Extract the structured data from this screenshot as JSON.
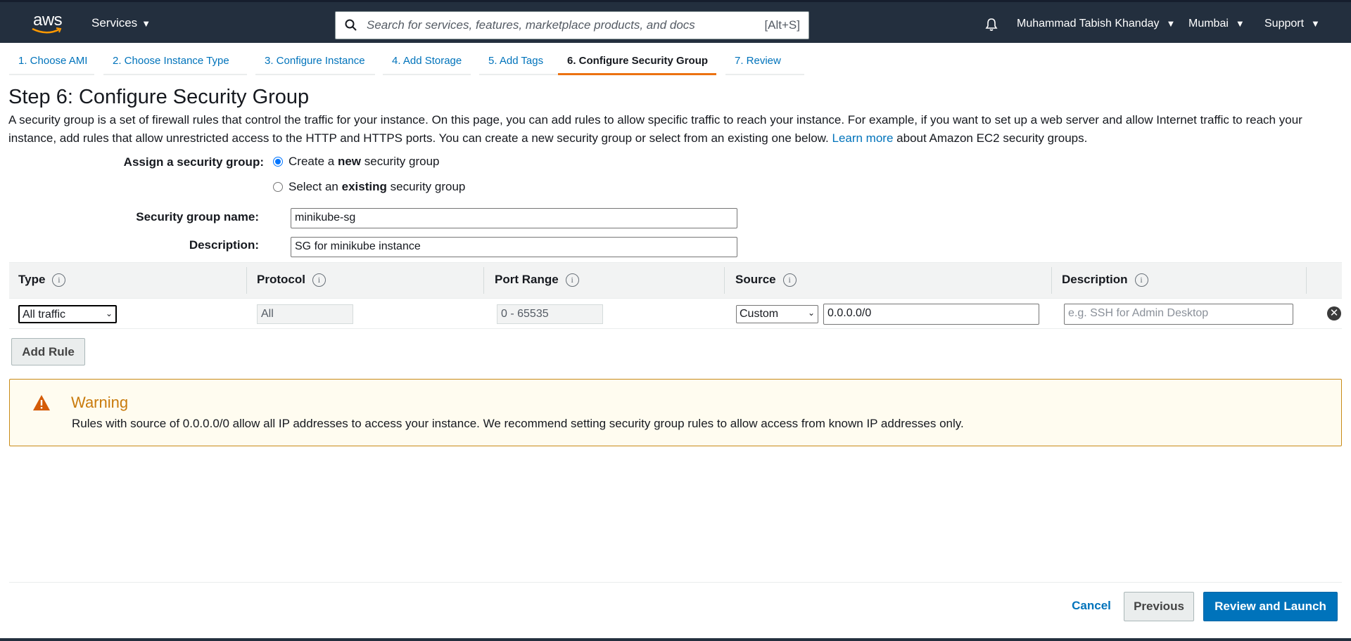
{
  "topnav": {
    "logo_text": "aws",
    "services_label": "Services",
    "search_placeholder": "Search for services, features, marketplace products, and docs",
    "search_shortcut": "[Alt+S]",
    "user": "Muhammad Tabish Khanday",
    "region": "Mumbai",
    "support": "Support"
  },
  "tabs": [
    {
      "label": "1. Choose AMI"
    },
    {
      "label": "2. Choose Instance Type"
    },
    {
      "label": "3. Configure Instance"
    },
    {
      "label": "4. Add Storage"
    },
    {
      "label": "5. Add Tags"
    },
    {
      "label": "6. Configure Security Group"
    },
    {
      "label": "7. Review"
    }
  ],
  "page": {
    "title": "Step 6: Configure Security Group",
    "intro_1": "A security group is a set of firewall rules that control the traffic for your instance. On this page, you can add rules to allow specific traffic to reach your instance. For example, if you want to set up a web server and allow Internet traffic to reach your instance, add rules that allow unrestricted access to the HTTP and HTTPS ports. You can create a new security group or select from an existing one below.",
    "learn_more": "Learn more",
    "intro_2": "about Amazon EC2 security groups."
  },
  "assign": {
    "label": "Assign a security group:",
    "option_new_pre": "Create a",
    "option_new_bold": "new",
    "option_new_post": "security group",
    "option_existing_pre": "Select an",
    "option_existing_bold": "existing",
    "option_existing_post": "security group"
  },
  "form": {
    "name_label": "Security group name:",
    "name_value": "minikube-sg",
    "desc_label": "Description:",
    "desc_value": "SG for minikube instance"
  },
  "rules_table": {
    "headers": [
      "Type",
      "Protocol",
      "Port Range",
      "Source",
      "Description"
    ],
    "row": {
      "type": "All traffic",
      "protocol": "All",
      "port_range": "0 - 65535",
      "source_type": "Custom",
      "source_cidr": "0.0.0.0/0",
      "description_placeholder": "e.g. SSH for Admin Desktop"
    },
    "add_rule": "Add Rule"
  },
  "warning": {
    "title": "Warning",
    "body": "Rules with source of 0.0.0.0/0 allow all IP addresses to access your instance. We recommend setting security group rules to allow access from known IP addresses only."
  },
  "footer": {
    "cancel": "Cancel",
    "previous": "Previous",
    "review_launch": "Review and Launch"
  },
  "colors": {
    "nav_bg": "#232f3e",
    "link": "#0073bb",
    "accent": "#ec7211",
    "warning": "#c97b0d"
  }
}
